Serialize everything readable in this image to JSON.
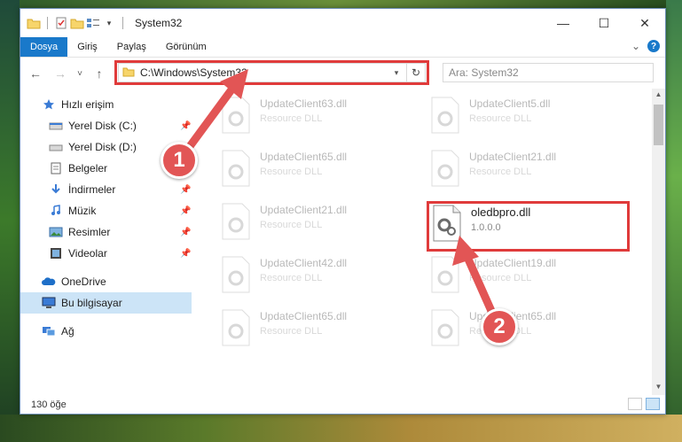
{
  "window": {
    "title": "System32",
    "controls": {
      "minimize": "—",
      "maximize": "☐",
      "close": "✕"
    }
  },
  "ribbon": {
    "tabs": [
      "Dosya",
      "Giriş",
      "Paylaş",
      "Görünüm"
    ],
    "active_tab": "Dosya",
    "expand_glyph": "⌄",
    "help_glyph": "?"
  },
  "address": {
    "path": "C:\\Windows\\System32",
    "refresh_glyph": "↻",
    "dropdown_glyph": "▾"
  },
  "search": {
    "placeholder": "Ara: System32"
  },
  "nav_glyphs": {
    "back": "←",
    "forward": "→",
    "recent": "˅",
    "up": "↑"
  },
  "sidebar": {
    "quick_access": "Hızlı erişim",
    "items": [
      {
        "label": "Yerel Disk (C:)",
        "icon": "drive-icon",
        "pinned": true
      },
      {
        "label": "Yerel Disk (D:)",
        "icon": "drive-icon",
        "pinned": false
      },
      {
        "label": "Belgeler",
        "icon": "documents-icon",
        "pinned": true
      },
      {
        "label": "İndirmeler",
        "icon": "downloads-icon",
        "pinned": true
      },
      {
        "label": "Müzik",
        "icon": "music-icon",
        "pinned": true
      },
      {
        "label": "Resimler",
        "icon": "pictures-icon",
        "pinned": true
      },
      {
        "label": "Videolar",
        "icon": "videos-icon",
        "pinned": true
      }
    ],
    "onedrive": "OneDrive",
    "this_pc": "Bu bilgisayar",
    "network": "Ağ"
  },
  "files": [
    {
      "name": "UpdateClient63.dll",
      "sub": "Resource DLL",
      "ghost": true
    },
    {
      "name": "UpdateClient5.dll",
      "sub": "Resource DLL",
      "ghost": true
    },
    {
      "name": "UpdateClient65.dll",
      "sub": "Resource DLL",
      "ghost": true
    },
    {
      "name": "UpdateClient21.dll",
      "sub": "Resource DLL",
      "ghost": true
    },
    {
      "name": "UpdateClient21.dll",
      "sub": "Resource DLL",
      "ghost": true
    },
    {
      "name": "oledbpro.dll",
      "sub": "1.0.0.0",
      "ghost": false
    },
    {
      "name": "UpdateClient42.dll",
      "sub": "Resource DLL",
      "ghost": true
    },
    {
      "name": "UpdateClient19.dll",
      "sub": "Resource DLL",
      "ghost": true
    },
    {
      "name": "UpdateClient65.dll",
      "sub": "Resource DLL",
      "ghost": true
    },
    {
      "name": "UpdateClient65.dll",
      "sub": "Resource DLL",
      "ghost": true
    }
  ],
  "status": {
    "item_count": "130 öğe"
  },
  "annotations": {
    "step1": "1",
    "step2": "2",
    "highlight_color": "#e03b3b"
  }
}
